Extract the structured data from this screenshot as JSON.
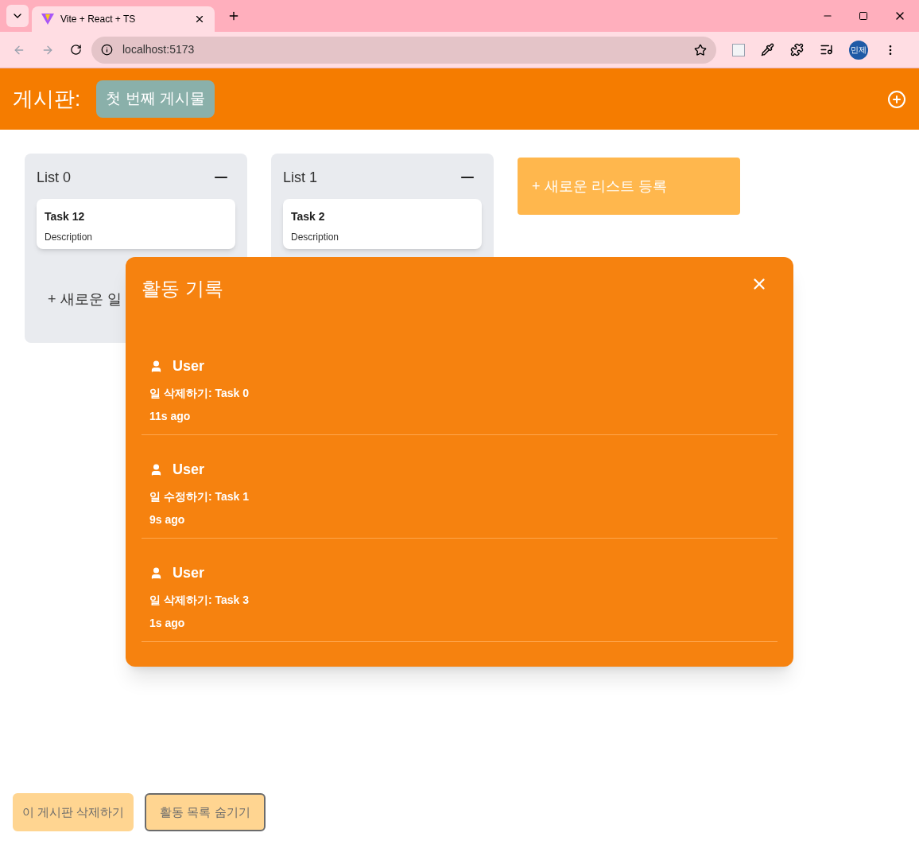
{
  "browser": {
    "tab_title": "Vite + React + TS",
    "url": "localhost:5173",
    "profile": "민제"
  },
  "header": {
    "label": "게시판:",
    "board_name": "첫 번째 게시물"
  },
  "lists": [
    {
      "title": "List 0",
      "tasks": [
        {
          "title": "Task 12",
          "description": "Description"
        }
      ],
      "add_task": "+ 새로운 일"
    },
    {
      "title": "List 1",
      "tasks": [
        {
          "title": "Task 2",
          "description": "Description"
        }
      ]
    }
  ],
  "add_list": "+ 새로운 리스트 등록",
  "activity": {
    "title": "활동 기록",
    "entries": [
      {
        "user": "User",
        "action": "일 삭제하기: Task 0",
        "time": "11s ago"
      },
      {
        "user": "User",
        "action": "일 수정하기: Task 1",
        "time": "9s ago"
      },
      {
        "user": "User",
        "action": "일 삭제하기: Task 3",
        "time": "1s ago"
      }
    ]
  },
  "buttons": [
    {
      "label": "이 게시판 삭제하기",
      "kind": "plain"
    },
    {
      "label": "활동 목록 숨기기",
      "kind": "outlined"
    }
  ]
}
